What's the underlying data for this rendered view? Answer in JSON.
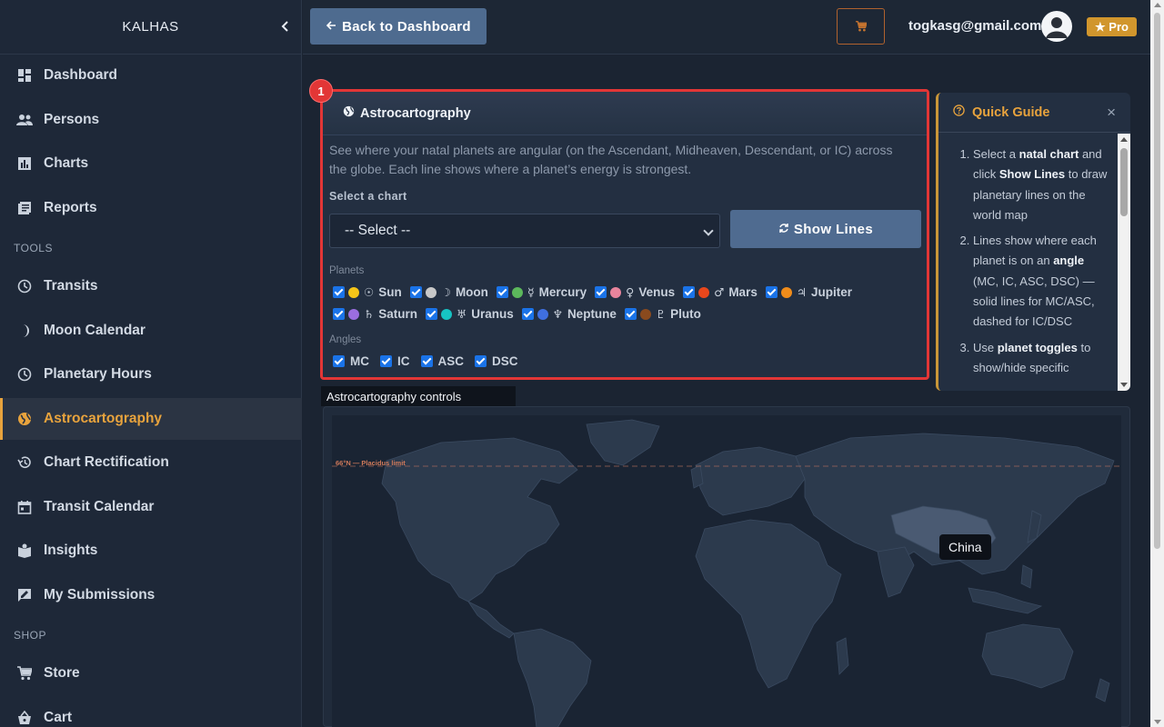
{
  "app": {
    "brand": "KALHAS"
  },
  "sidebar": {
    "items": [
      {
        "label": "Dashboard",
        "icon": "dashboard-icon"
      },
      {
        "label": "Persons",
        "icon": "people-icon"
      },
      {
        "label": "Charts",
        "icon": "bar-chart-icon"
      },
      {
        "label": "Reports",
        "icon": "reports-icon"
      },
      {
        "label": "Transits",
        "icon": "clock-icon"
      },
      {
        "label": "Moon Calendar",
        "icon": "moon-icon"
      },
      {
        "label": "Planetary Hours",
        "icon": "clock-icon"
      },
      {
        "label": "Astrocartography",
        "icon": "globe-icon",
        "active": true
      },
      {
        "label": "Chart Rectification",
        "icon": "history-icon"
      },
      {
        "label": "Transit Calendar",
        "icon": "calendar-icon"
      },
      {
        "label": "Insights",
        "icon": "book-icon"
      },
      {
        "label": "My Submissions",
        "icon": "submissions-icon"
      },
      {
        "label": "Store",
        "icon": "cart-icon"
      },
      {
        "label": "Cart",
        "icon": "basket-icon"
      }
    ],
    "sections": {
      "tools": "TOOLS",
      "shop": "SHOP"
    }
  },
  "topbar": {
    "back_label": "Back to Dashboard",
    "email": "togkasg@gmail.com",
    "pro_label": "★ Pro"
  },
  "panel": {
    "badge": "1",
    "title": "Astrocartography",
    "description": "See where your natal planets are angular (on the Ascendant, Midheaven, Descendant, or IC) across the globe. Each line shows where a planet’s energy is strongest.",
    "select_label": "Select a chart",
    "select_value": "-- Select --",
    "show_button": "Show Lines",
    "planets_label": "Planets",
    "planets": [
      {
        "glyph": "☉",
        "name": "Sun",
        "color": "#f5c518"
      },
      {
        "glyph": "☽",
        "name": "Moon",
        "color": "#c8c8c8"
      },
      {
        "glyph": "☿",
        "name": "Mercury",
        "color": "#5cb85c"
      },
      {
        "glyph": "♀",
        "name": "Venus",
        "color": "#e8849c"
      },
      {
        "glyph": "♂",
        "name": "Mars",
        "color": "#e8471c"
      },
      {
        "glyph": "♃",
        "name": "Jupiter",
        "color": "#f08c1a"
      },
      {
        "glyph": "♄",
        "name": "Saturn",
        "color": "#9b6ee0"
      },
      {
        "glyph": "♅",
        "name": "Uranus",
        "color": "#16c3c3"
      },
      {
        "glyph": "♆",
        "name": "Neptune",
        "color": "#3f6fe0"
      },
      {
        "glyph": "♇",
        "name": "Pluto",
        "color": "#8a4a1e"
      }
    ],
    "angles_label": "Angles",
    "angles": [
      "MC",
      "IC",
      "ASC",
      "DSC"
    ],
    "caption": "Astrocartography controls"
  },
  "guide": {
    "title": "Quick Guide",
    "step1": {
      "a": "Select a ",
      "b": "natal chart",
      "c": " and click ",
      "d": "Show Lines",
      "e": " to draw planetary lines on the world map"
    },
    "step2": {
      "a": "Lines show where each planet is on an ",
      "b": "angle",
      "c": " (MC, IC, ASC, DSC) — solid lines for MC/ASC, dashed for IC/DSC"
    },
    "step3": {
      "a": "Use ",
      "b": "planet toggles",
      "c": " to show/hide specific"
    }
  },
  "map": {
    "limit_label": "66°N — Placidus limit",
    "tooltip": "China"
  },
  "colors": {
    "accent": "#e8a33d",
    "highlight": "#e23636",
    "button": "#4f6b90"
  }
}
